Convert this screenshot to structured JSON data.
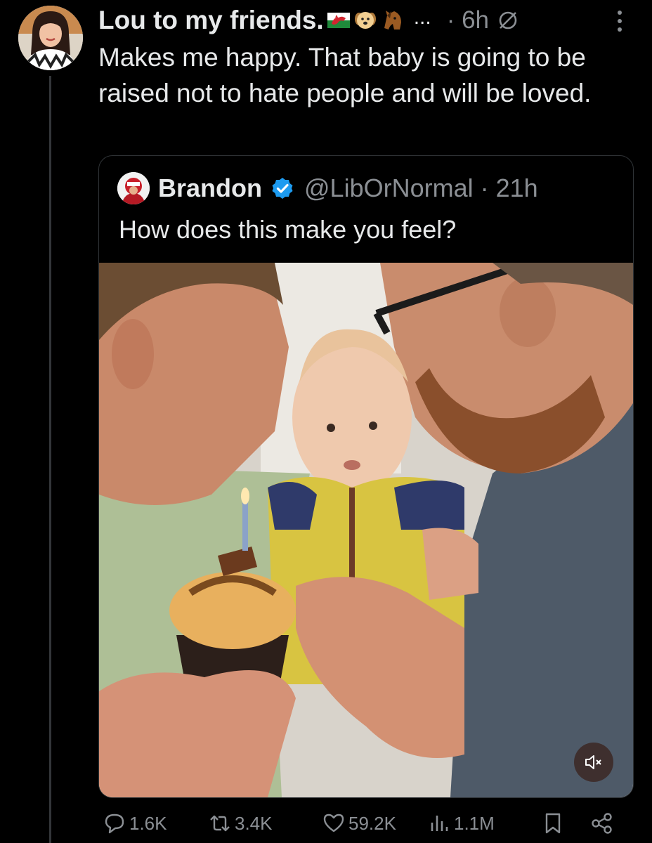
{
  "tweet": {
    "author_display_name": "Lou to my friends.",
    "author_name_emojis": [
      "wales-flag",
      "dog-face",
      "horse-face"
    ],
    "name_overflow": "...",
    "time": "· 6h",
    "text": "Makes me happy. That baby is going to be raised not to hate people and will be loved."
  },
  "quoted_tweet": {
    "display_name": "Brandon",
    "verified": true,
    "handle_time": "@LibOrNormal · 21h",
    "text": "How does this make you feel?",
    "media": {
      "type": "video",
      "muted": true
    }
  },
  "actions": {
    "replies": "1.6K",
    "reposts": "3.4K",
    "likes": "59.2K",
    "views": "1.1M"
  },
  "icons": {
    "more": "more-vertical-icon",
    "no-notifications": "circle-slash-icon",
    "reply": "speech-bubble-icon",
    "repost": "repost-arrows-icon",
    "like": "heart-outline-icon",
    "views": "bar-chart-icon",
    "bookmark": "bookmark-outline-icon",
    "share": "share-nodes-icon",
    "mute": "speaker-muted-icon",
    "verified": "verified-badge-icon"
  },
  "colors": {
    "background": "#000000",
    "text_primary": "#e7e9ea",
    "text_secondary": "#8b8f94",
    "border": "#2f3336",
    "verified_blue": "#1d9bf0"
  }
}
